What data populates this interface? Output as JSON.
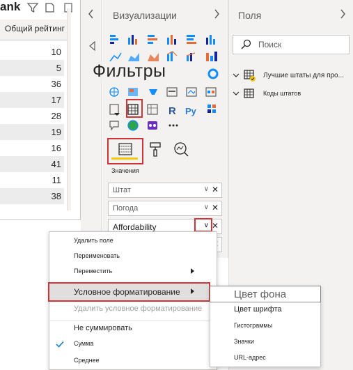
{
  "table": {
    "title": "ank",
    "column_header": "Общий рейтинг",
    "values": [
      "10",
      "5",
      "36",
      "17",
      "28",
      "19",
      "16",
      "41",
      "11",
      "38"
    ]
  },
  "visualizations": {
    "title": "Визуализации",
    "overlay_label": "Фильтры",
    "values_tab_label": "Значения",
    "fields": [
      {
        "label": "Штат"
      },
      {
        "label": "Погода"
      },
      {
        "label": "Affordability"
      },
      {
        "label": ""
      }
    ]
  },
  "fields_pane": {
    "title": "Поля",
    "search_placeholder": "Поиск",
    "tables": [
      {
        "label": "Лучшие штаты для про..."
      },
      {
        "label": "Коды штатов"
      }
    ]
  },
  "context_menu": {
    "items": [
      {
        "label": "Удалить поле"
      },
      {
        "label": "Переименовать"
      },
      {
        "label": "Переместить"
      },
      {
        "label": "Условное форматирование"
      },
      {
        "label": "Удалить условное форматирование"
      },
      {
        "label": "Не суммировать"
      },
      {
        "label": "Сумма"
      },
      {
        "label": "Среднее"
      }
    ]
  },
  "submenu": {
    "items": [
      {
        "label": "Цвет фона"
      },
      {
        "label": "Цвет шрифта"
      },
      {
        "label": "Гистограммы"
      },
      {
        "label": "Значки"
      },
      {
        "label": "URL-адрес"
      }
    ]
  },
  "colors": {
    "highlight_red": "#d13438",
    "accent_yellow": "#f2c811",
    "pane_bg": "#f3f2f1",
    "check_blue": "#0078d4"
  }
}
